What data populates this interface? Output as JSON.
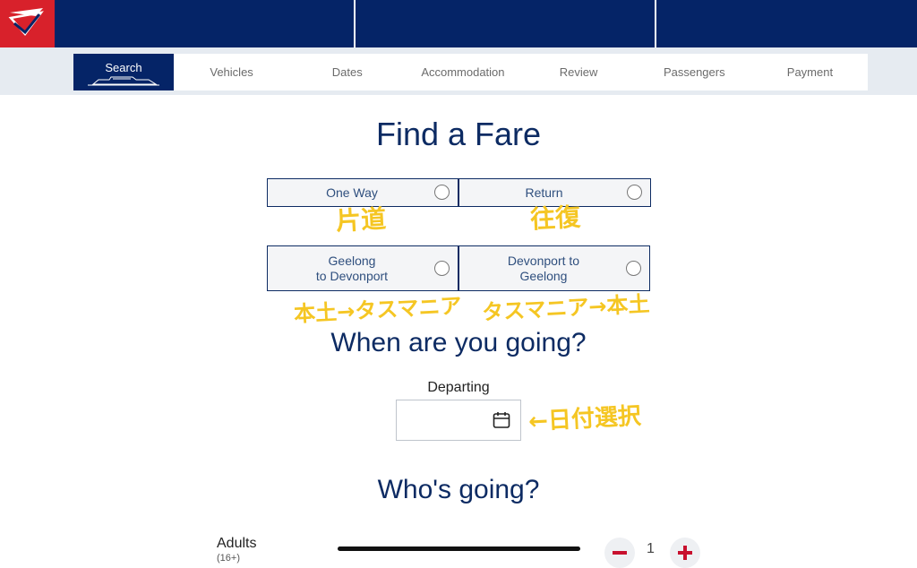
{
  "steps": [
    {
      "label": "Search",
      "active": true
    },
    {
      "label": "Vehicles"
    },
    {
      "label": "Dates"
    },
    {
      "label": "Accommodation"
    },
    {
      "label": "Review"
    },
    {
      "label": "Passengers"
    },
    {
      "label": "Payment"
    }
  ],
  "headings": {
    "find_fare": "Find a Fare",
    "when": "When are you going?",
    "who": "Who's going?"
  },
  "trip_type": {
    "one_way": "One Way",
    "return": "Return"
  },
  "route": {
    "geelong_line1": "Geelong",
    "geelong_line2": "to Devonport",
    "devonport_line1": "Devonport to",
    "devonport_line2": "Geelong"
  },
  "annotations": {
    "one_way": "片道",
    "return": "往復",
    "to_tas": "本土→タスマニア",
    "to_main": "タスマニア→本土",
    "date_pick": "←日付選択"
  },
  "departing": {
    "label": "Departing",
    "value": ""
  },
  "passengers": {
    "adults_label": "Adults",
    "adults_sub": "(16+)",
    "adults_count": "1"
  },
  "colors": {
    "brand_navy": "#052467",
    "brand_red": "#d8212b",
    "annotation_yellow": "#f5c623"
  }
}
